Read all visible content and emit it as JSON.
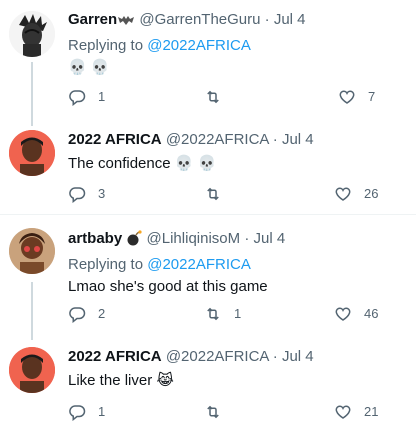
{
  "colors": {
    "link": "#1d9bf0",
    "muted": "#536471",
    "text": "#0f1419",
    "line": "#cfd9de"
  },
  "tweets": [
    {
      "name": "Garren",
      "name_badge": "bat-icon",
      "handle": "@GarrenTheGuru",
      "dot": "·",
      "date": "Jul 4",
      "replying_prefix": "Replying to ",
      "replying_to": "@2022AFRICA",
      "text": "💀 💀",
      "replies": "1",
      "retweets": "",
      "likes": "7"
    },
    {
      "name": "2022 AFRICA",
      "handle": "@2022AFRICA",
      "dot": "·",
      "date": "Jul 4",
      "text": "The confidence 💀 💀",
      "replies": "3",
      "retweets": "",
      "likes": "26"
    },
    {
      "name": "artbaby",
      "name_badge": "bomb-icon",
      "handle": "@LihliqinisoM",
      "dot": "·",
      "date": "Jul 4",
      "replying_prefix": "Replying to ",
      "replying_to": "@2022AFRICA",
      "text": "Lmao she's good at this game",
      "replies": "2",
      "retweets": "1",
      "likes": "46"
    },
    {
      "name": "2022 AFRICA",
      "handle": "@2022AFRICA",
      "dot": "·",
      "date": "Jul 4",
      "text": "Like the liver 😹",
      "replies": "1",
      "retweets": "",
      "likes": "21"
    }
  ]
}
